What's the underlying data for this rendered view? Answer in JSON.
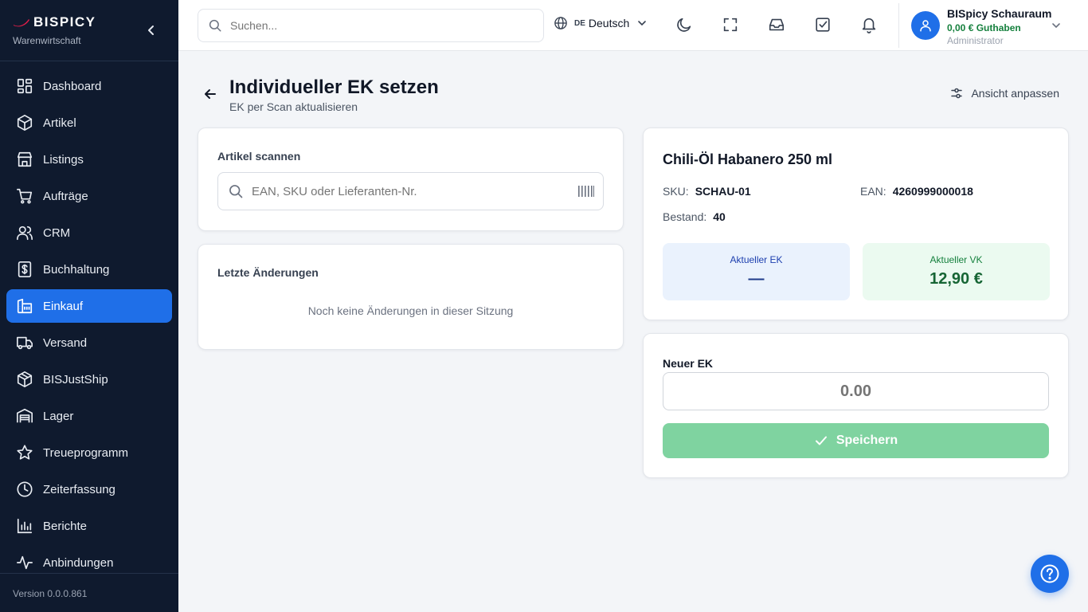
{
  "brand": {
    "name": "BISPICY",
    "subtitle": "Warenwirtschaft"
  },
  "sidebar": {
    "items": [
      {
        "label": "Dashboard",
        "icon": "dashboard-icon"
      },
      {
        "label": "Artikel",
        "icon": "box-icon"
      },
      {
        "label": "Listings",
        "icon": "store-icon"
      },
      {
        "label": "Aufträge",
        "icon": "cart-icon"
      },
      {
        "label": "CRM",
        "icon": "users-icon"
      },
      {
        "label": "Buchhaltung",
        "icon": "receipt-icon"
      },
      {
        "label": "Einkauf",
        "icon": "warehouse-icon",
        "active": true
      },
      {
        "label": "Versand",
        "icon": "truck-icon"
      },
      {
        "label": "BISJustShip",
        "icon": "package-icon"
      },
      {
        "label": "Lager",
        "icon": "garage-icon"
      },
      {
        "label": "Treueprogramm",
        "icon": "star-icon"
      },
      {
        "label": "Zeiterfassung",
        "icon": "clock-icon"
      },
      {
        "label": "Berichte",
        "icon": "bar-chart-icon"
      },
      {
        "label": "Anbindungen",
        "icon": "activity-icon"
      }
    ],
    "version": "Version 0.0.0.861"
  },
  "topbar": {
    "search_placeholder": "Suchen...",
    "language_code": "DE",
    "language_label": "Deutsch",
    "user": {
      "name": "BISpicy Schauraum",
      "credit": "0,00 € Guthaben",
      "role": "Administrator"
    }
  },
  "page": {
    "title": "Individueller EK setzen",
    "subtitle": "EK per Scan aktualisieren",
    "view_button": "Ansicht anpassen"
  },
  "scan_card": {
    "label": "Artikel scannen",
    "input_placeholder": "EAN, SKU oder Lieferanten-Nr."
  },
  "changes_card": {
    "label": "Letzte Änderungen",
    "empty_message": "Noch keine Änderungen in dieser Sitzung"
  },
  "product": {
    "name": "Chili-Öl Habanero 250 ml",
    "sku_label": "SKU:",
    "sku": "SCHAU-01",
    "ean_label": "EAN:",
    "ean": "4260999000018",
    "stock_label": "Bestand:",
    "stock": "40",
    "current_ek_label": "Aktueller EK",
    "current_ek": "—",
    "current_vk_label": "Aktueller VK",
    "current_vk": "12,90 €"
  },
  "ek_form": {
    "label": "Neuer EK",
    "input_placeholder": "0.00",
    "save_button": "Speichern"
  },
  "colors": {
    "sidebar_bg": "#0f1a2e",
    "accent": "#1f6fe8",
    "success": "#15803d",
    "save_button_disabled": "#7fd3a0"
  }
}
